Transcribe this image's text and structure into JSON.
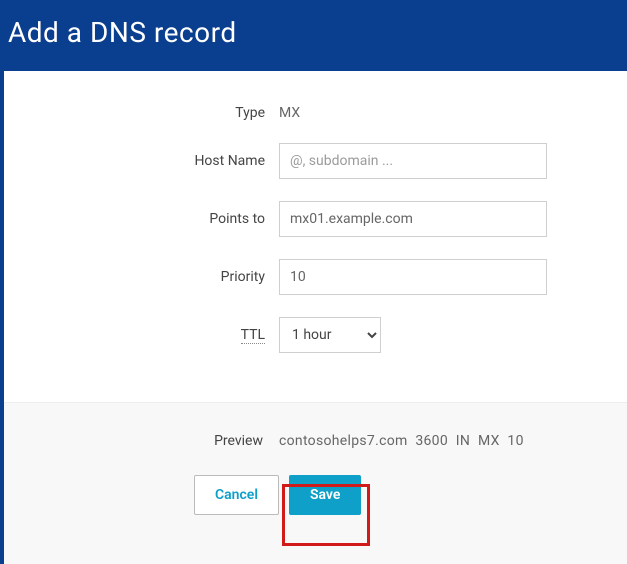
{
  "header": {
    "title": "Add a DNS record"
  },
  "form": {
    "type": {
      "label": "Type",
      "value": "MX"
    },
    "hostName": {
      "label": "Host Name",
      "placeholder": "@, subdomain ...",
      "value": ""
    },
    "pointsTo": {
      "label": "Points to",
      "value": "mx01.example.com"
    },
    "priority": {
      "label": "Priority",
      "value": "10"
    },
    "ttl": {
      "label": "TTL",
      "value": "1 hour"
    }
  },
  "preview": {
    "label": "Preview",
    "text": "contosohelps7.com  3600  IN  MX  10"
  },
  "buttons": {
    "cancel": "Cancel",
    "save": "Save"
  }
}
